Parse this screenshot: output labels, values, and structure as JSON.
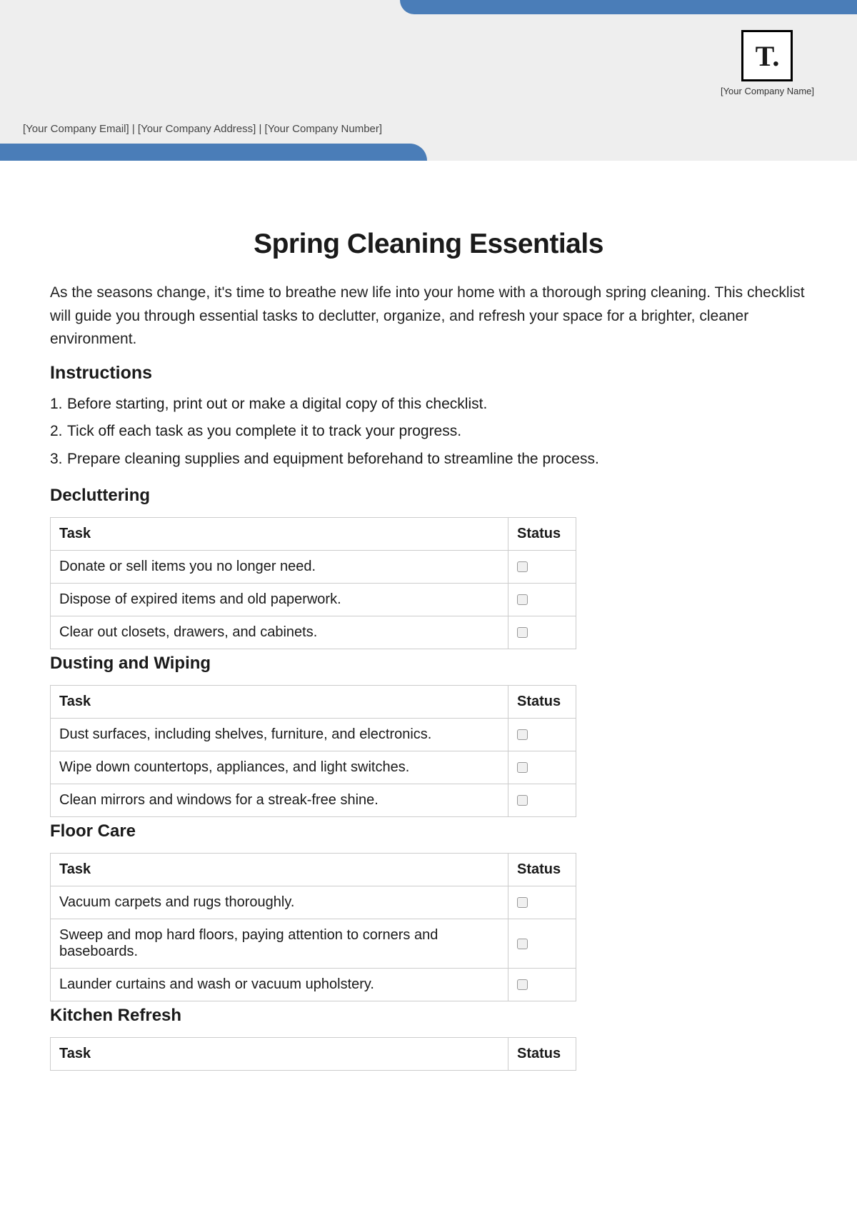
{
  "header": {
    "logo_text": "T.",
    "company_name_placeholder": "[Your Company Name]",
    "contact_email": "[Your Company Email]",
    "contact_address": "[Your Company Address]",
    "contact_number": "[Your Company Number]",
    "separator": "  |  "
  },
  "title": "Spring Cleaning Essentials",
  "intro": "As the seasons change, it's time to breathe new life into your home with a thorough spring cleaning. This checklist will guide you through essential tasks to declutter, organize, and refresh your space for a brighter, cleaner environment.",
  "instructions_heading": "Instructions",
  "instructions": [
    "Before starting, print out or make a digital copy of this checklist.",
    "Tick off each task as you complete it to track your progress.",
    "Prepare cleaning supplies and equipment beforehand to streamline the process."
  ],
  "columns": {
    "task": "Task",
    "status": "Status"
  },
  "sections": [
    {
      "heading": "Decluttering",
      "tasks": [
        "Donate or sell items you no longer need.",
        "Dispose of expired items and old paperwork.",
        "Clear out closets, drawers, and cabinets."
      ]
    },
    {
      "heading": "Dusting and Wiping",
      "tasks": [
        "Dust surfaces, including shelves, furniture, and electronics.",
        "Wipe down countertops, appliances, and light switches.",
        "Clean mirrors and windows for a streak-free shine."
      ]
    },
    {
      "heading": "Floor Care",
      "tasks": [
        "Vacuum carpets and rugs thoroughly.",
        "Sweep and mop hard floors, paying attention to corners and baseboards.",
        "Launder curtains and wash or vacuum upholstery."
      ]
    },
    {
      "heading": "Kitchen Refresh",
      "tasks": []
    }
  ]
}
